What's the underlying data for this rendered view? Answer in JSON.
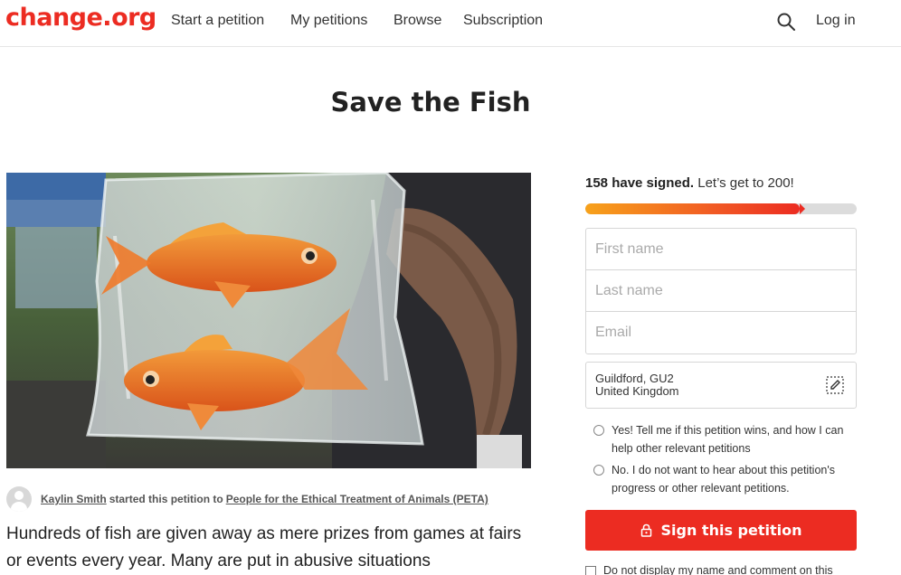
{
  "header": {
    "logo": "change.org",
    "nav": [
      "Start a petition",
      "My petitions",
      "Browse",
      "Subscription"
    ],
    "login": "Log in",
    "search_icon": "search-icon"
  },
  "petition": {
    "title": "Save the Fish",
    "starter_name": "Kaylin Smith",
    "starter_mid": "started this petition to",
    "recipient": "People for the Ethical Treatment of Animals (PETA)",
    "description": "Hundreds of fish are given away as mere prizes from games at fairs or events every year. Many are put in abusive situations"
  },
  "signing": {
    "signed_count": "158 have signed.",
    "goal_text": " Let’s get to 200!",
    "progress_fraction": 0.79,
    "first_name_placeholder": "First name",
    "last_name_placeholder": "Last name",
    "email_placeholder": "Email",
    "location_line1": "Guildford, GU2",
    "location_line2": "United Kingdom",
    "opt_in_yes": "Yes! Tell me if this petition wins, and how I can help other relevant petitions",
    "opt_in_no": "No. I do not want to hear about this petition's progress or other relevant petitions.",
    "sign_button": "Sign this petition",
    "hide_name": "Do not display my name and comment on this"
  },
  "colors": {
    "brand": "#ec2c22",
    "progress_start": "#f7a21b",
    "progress_end": "#ec2c22"
  }
}
